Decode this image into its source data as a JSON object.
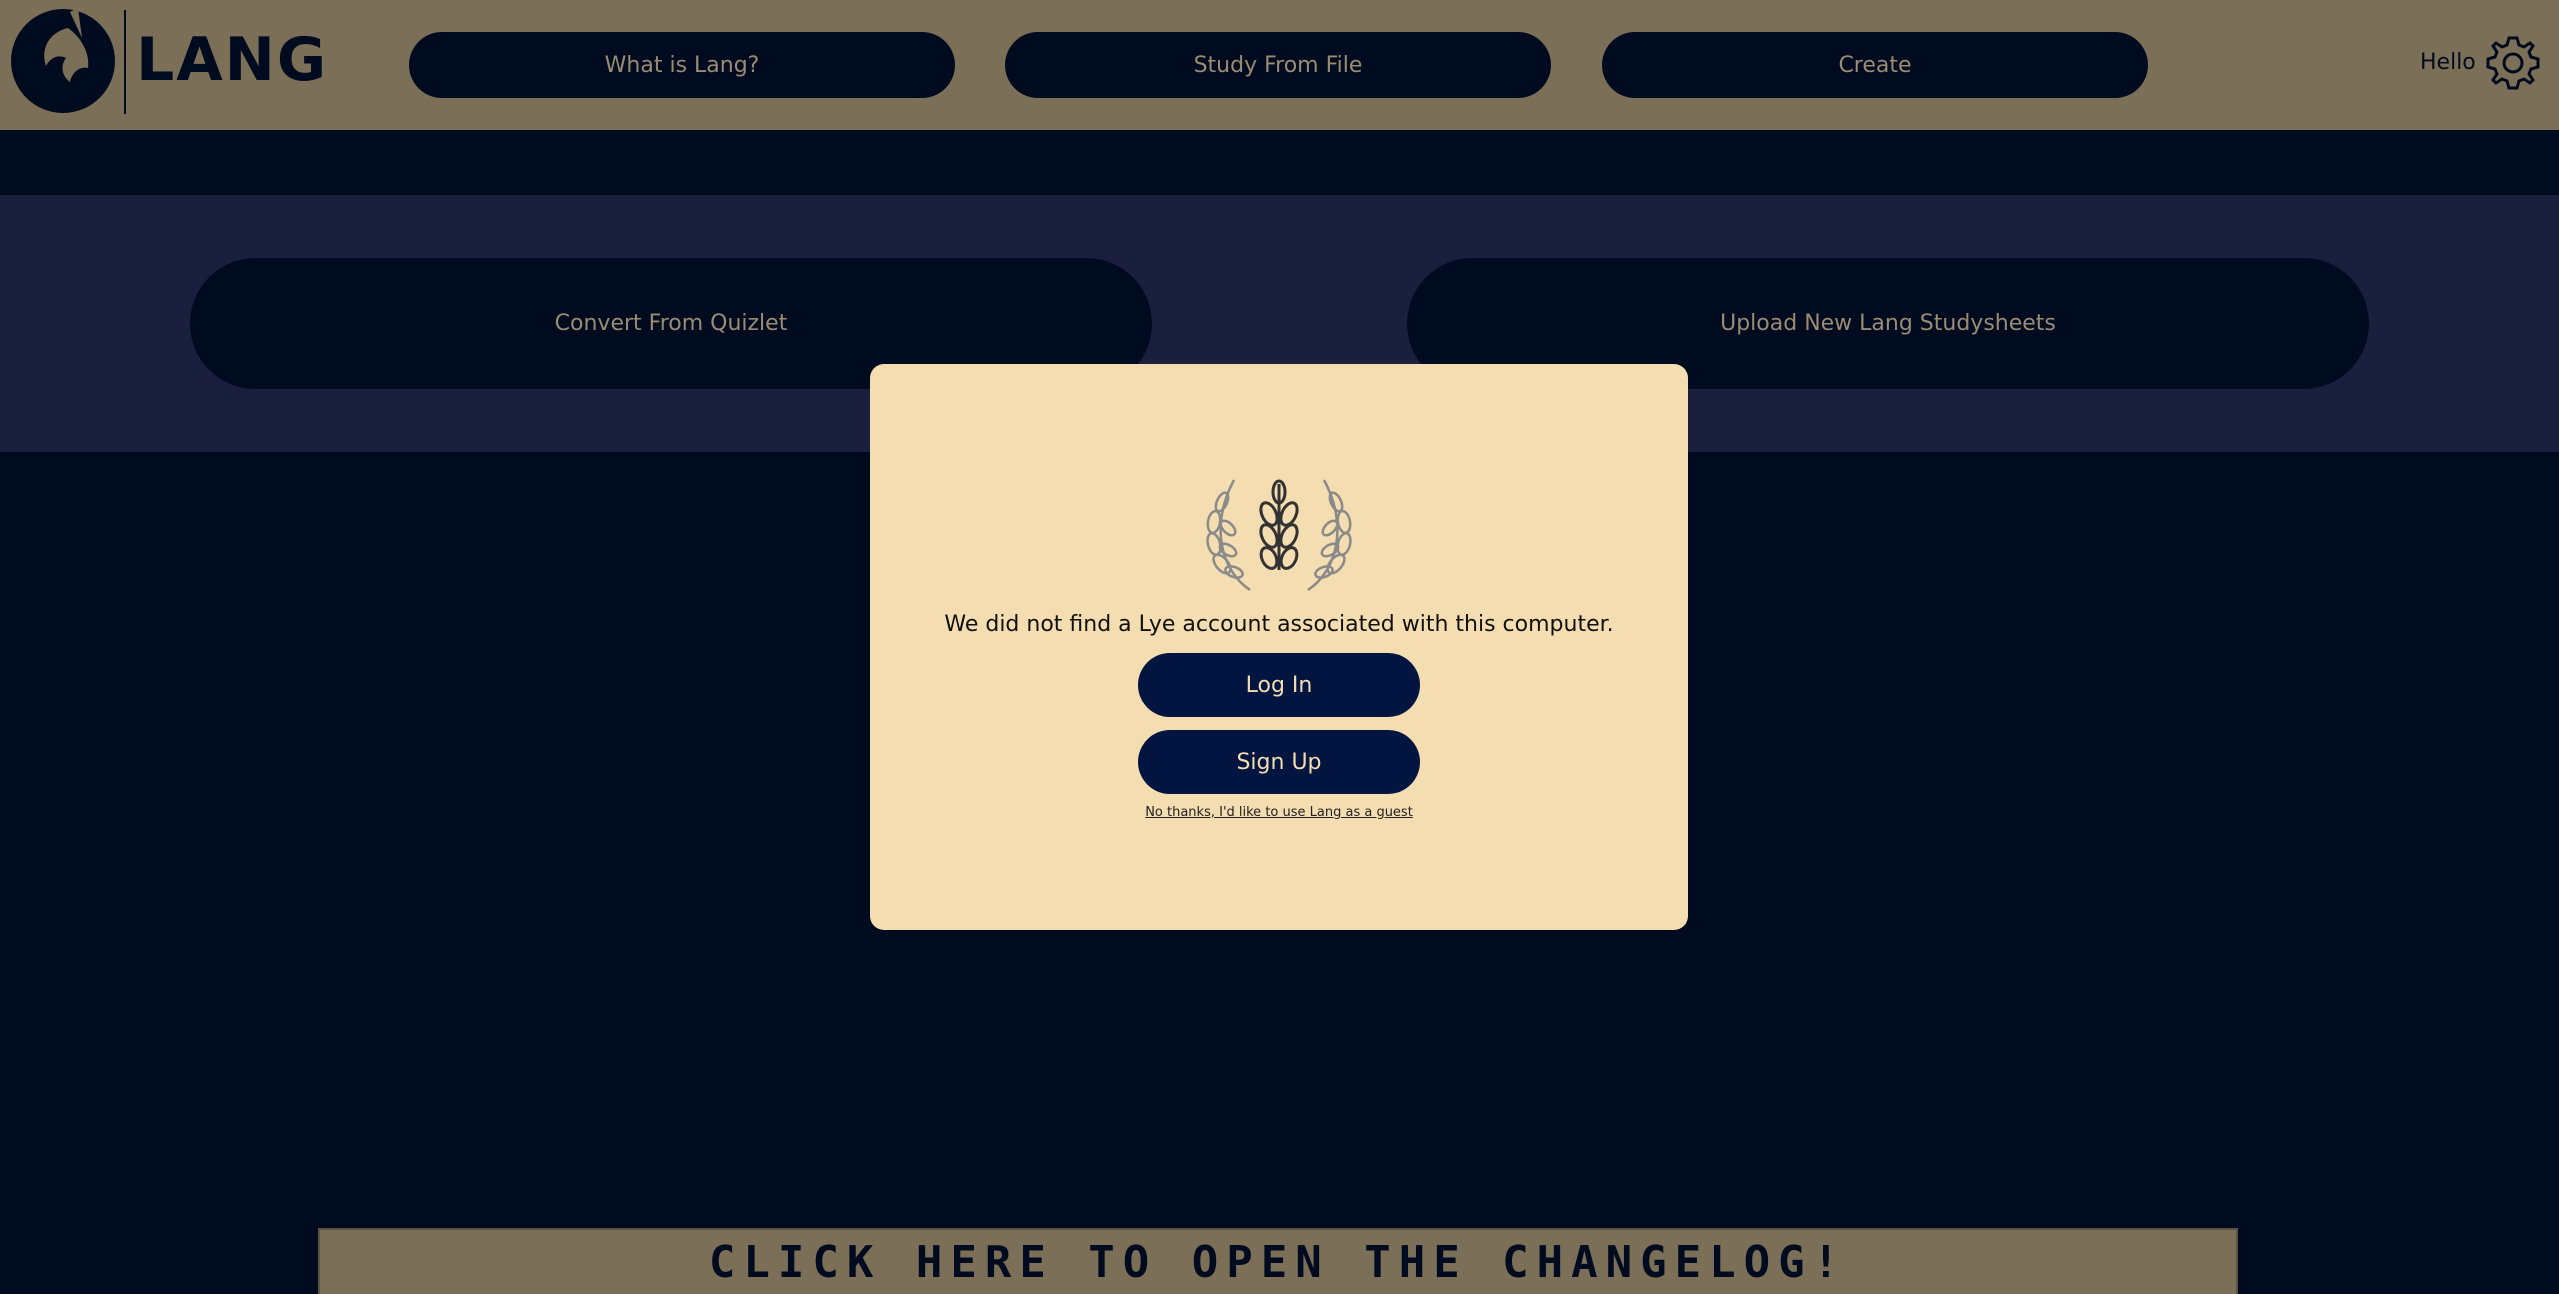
{
  "header": {
    "logo_text": "LANG",
    "nav": [
      {
        "label": "What is Lang?"
      },
      {
        "label": "Study From File"
      },
      {
        "label": "Create"
      }
    ],
    "greeting": "Hello",
    "settings_icon": "gear-icon"
  },
  "band": {
    "buttons": [
      {
        "label": "Convert From Quizlet"
      },
      {
        "label": "Upload New Lang Studysheets"
      }
    ]
  },
  "modal": {
    "emblem_icon": "laurel-wheat-icon",
    "message": "We did not find a Lye account associated with this computer.",
    "login_label": "Log In",
    "signup_label": "Sign Up",
    "guest_label": "No thanks, I'd like to use Lang as a guest"
  },
  "changelog": {
    "label": "CLICK HERE TO OPEN THE CHANGELOG!"
  },
  "colors": {
    "header_bg": "#7c6f58",
    "page_bg": "#000b1f",
    "band_bg": "#1a1f3d",
    "modal_bg": "#f4ddb0",
    "modal_button_bg": "#021540",
    "nav_text": "#9a8b72"
  }
}
